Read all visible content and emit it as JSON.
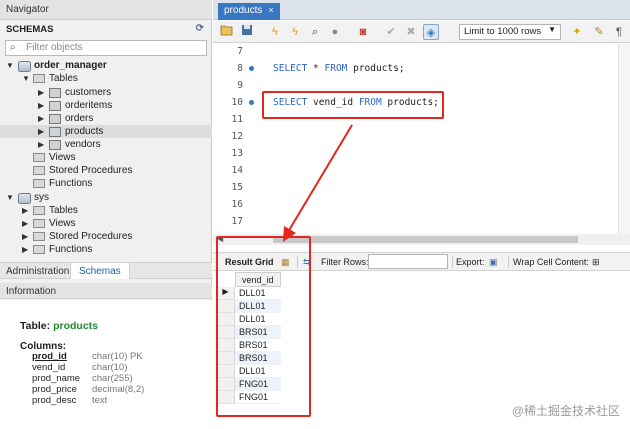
{
  "navigator": {
    "title": "Navigator",
    "schemas_label": "SCHEMAS",
    "filter_placeholder": "Filter objects",
    "schemas": [
      {
        "name": "order_manager",
        "tables_label": "Tables",
        "tables": [
          "customers",
          "orderitems",
          "orders",
          "products",
          "vendors"
        ],
        "others": [
          "Views",
          "Stored Procedures",
          "Functions"
        ]
      },
      {
        "name": "sys",
        "children": [
          "Tables",
          "Views",
          "Stored Procedures",
          "Functions"
        ]
      }
    ],
    "selected_table": "products"
  },
  "panel_tabs": {
    "administration": "Administration",
    "schemas": "Schemas"
  },
  "info": {
    "title": "Information",
    "table_label": "Table:",
    "table_name": "products",
    "columns_label": "Columns:",
    "columns": [
      {
        "name": "prod_id",
        "type": "char(10) PK"
      },
      {
        "name": "vend_id",
        "type": "char(10)"
      },
      {
        "name": "prod_name",
        "type": "char(255)"
      },
      {
        "name": "prod_price",
        "type": "decimal(8,2)"
      },
      {
        "name": "prod_desc",
        "type": "text"
      }
    ]
  },
  "editor_tab": {
    "label": "products",
    "close": "×"
  },
  "toolbar": {
    "limit_label": "Limit to 1000 rows"
  },
  "editor": {
    "lines": [
      {
        "num": "7",
        "dot": false,
        "code_kw1": "",
        "code_mid": "",
        "code_kw2": "",
        "code_end": ""
      },
      {
        "num": "8",
        "dot": true,
        "code_kw1": "SELECT",
        "code_mid": " * ",
        "code_kw2": "FROM",
        "code_end": " products;"
      },
      {
        "num": "9",
        "dot": false,
        "code_kw1": "",
        "code_mid": "",
        "code_kw2": "",
        "code_end": ""
      },
      {
        "num": "10",
        "dot": true,
        "code_kw1": "SELECT",
        "code_mid": " vend_id ",
        "code_kw2": "FROM",
        "code_end": " products;"
      },
      {
        "num": "11",
        "dot": false,
        "code_kw1": "",
        "code_mid": "",
        "code_kw2": "",
        "code_end": ""
      },
      {
        "num": "12",
        "dot": false,
        "code_kw1": "",
        "code_mid": "",
        "code_kw2": "",
        "code_end": ""
      },
      {
        "num": "13",
        "dot": false,
        "code_kw1": "",
        "code_mid": "",
        "code_kw2": "",
        "code_end": ""
      },
      {
        "num": "14",
        "dot": false,
        "code_kw1": "",
        "code_mid": "",
        "code_kw2": "",
        "code_end": ""
      },
      {
        "num": "15",
        "dot": false,
        "code_kw1": "",
        "code_mid": "",
        "code_kw2": "",
        "code_end": ""
      },
      {
        "num": "16",
        "dot": false,
        "code_kw1": "",
        "code_mid": "",
        "code_kw2": "",
        "code_end": ""
      },
      {
        "num": "17",
        "dot": false,
        "code_kw1": "",
        "code_mid": "",
        "code_kw2": "",
        "code_end": ""
      }
    ]
  },
  "result": {
    "grid_label": "Result Grid",
    "filter_rows_label": "Filter Rows:",
    "export_label": "Export:",
    "wrap_label": "Wrap Cell Content:",
    "column": "vend_id",
    "rows": [
      "DLL01",
      "DLL01",
      "DLL01",
      "BRS01",
      "BRS01",
      "BRS01",
      "DLL01",
      "FNG01",
      "FNG01"
    ]
  },
  "annotation_color": "#e2271d",
  "accent_color": "#3a77c3",
  "watermark": "@稀土掘金技术社区"
}
